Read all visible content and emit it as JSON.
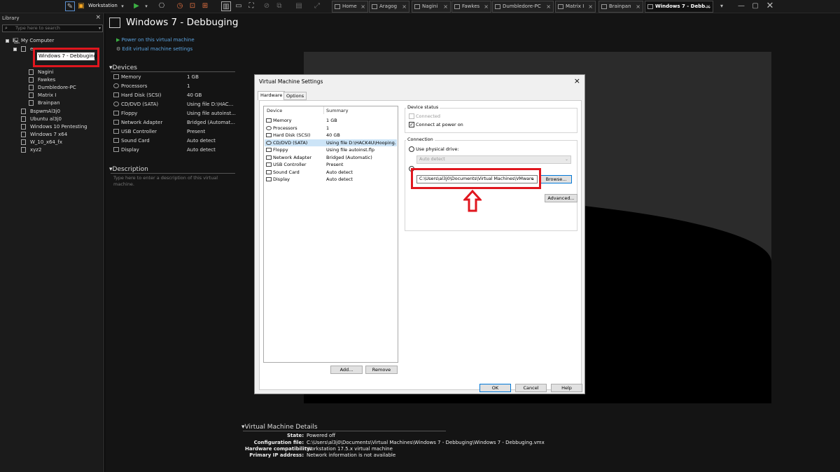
{
  "toolbar": {
    "product": "Workstation"
  },
  "tabs": [
    {
      "label": "Home"
    },
    {
      "label": "Aragog"
    },
    {
      "label": "Nagini"
    },
    {
      "label": "Fawkes"
    },
    {
      "label": "Dumbledore-PC"
    },
    {
      "label": "Matrix I"
    },
    {
      "label": "Brainpan"
    },
    {
      "label": "Windows 7 - Debb..."
    }
  ],
  "library": {
    "title": "Library",
    "close": "×",
    "search_placeholder": "Type here to search",
    "root": "My Computer",
    "group_label": "e",
    "editing_name": "Windows 7 - Debbuging",
    "children": [
      "Nagini",
      "Fawkes",
      "Dumbledore-PC",
      "Matrix I",
      "Brainpan"
    ],
    "items": [
      "BspwmAl3j0",
      "Ubuntu al3j0",
      "Windows 10 Pentesting",
      "Windows 7 x64",
      "W_10_x64_fx",
      "xyz2"
    ]
  },
  "vm": {
    "title": "Windows 7 - Debbuging",
    "actions": {
      "power_on": "Power on this virtual machine",
      "edit": "Edit virtual machine settings"
    },
    "devices_title": "Devices",
    "devices": [
      {
        "name": "Memory",
        "value": "1 GB"
      },
      {
        "name": "Processors",
        "value": "1"
      },
      {
        "name": "Hard Disk (SCSI)",
        "value": "40 GB"
      },
      {
        "name": "CD/DVD (SATA)",
        "value": "Using file D:\\HAC..."
      },
      {
        "name": "Floppy",
        "value": "Using file autoinst..."
      },
      {
        "name": "Network Adapter",
        "value": "Bridged (Automat..."
      },
      {
        "name": "USB Controller",
        "value": "Present"
      },
      {
        "name": "Sound Card",
        "value": "Auto detect"
      },
      {
        "name": "Display",
        "value": "Auto detect"
      }
    ],
    "description_title": "Description",
    "description_placeholder": "Type here to enter a description of this virtual machine.",
    "details_title": "Virtual Machine Details",
    "details": [
      {
        "label": "State:",
        "value": "Powered off"
      },
      {
        "label": "Configuration file:",
        "value": "C:\\Users\\al3j0\\Documents\\Virtual Machines\\Windows 7 - Debbuging\\Windows 7 - Debbuging.vmx"
      },
      {
        "label": "Hardware compatibility:",
        "value": "Workstation 17.5.x virtual machine"
      },
      {
        "label": "Primary IP address:",
        "value": "Network information is not available"
      }
    ]
  },
  "dialog": {
    "title": "Virtual Machine Settings",
    "close": "×",
    "tabs": [
      "Hardware",
      "Options"
    ],
    "list_headers": {
      "device": "Device",
      "summary": "Summary"
    },
    "rows": [
      {
        "name": "Memory",
        "value": "1 GB"
      },
      {
        "name": "Processors",
        "value": "1"
      },
      {
        "name": "Hard Disk (SCSI)",
        "value": "40 GB"
      },
      {
        "name": "CD/DVD (SATA)",
        "value": "Using file D:\\HACK4U\\Hooping..."
      },
      {
        "name": "Floppy",
        "value": "Using file autoinst.flp"
      },
      {
        "name": "Network Adapter",
        "value": "Bridged (Automatic)"
      },
      {
        "name": "USB Controller",
        "value": "Present"
      },
      {
        "name": "Sound Card",
        "value": "Auto detect"
      },
      {
        "name": "Display",
        "value": "Auto detect"
      }
    ],
    "add": "Add...",
    "remove": "Remove",
    "device_status": "Device status",
    "connected": "Connected",
    "connect_power": "Connect at power on",
    "connection": "Connection",
    "physical": "Use physical drive:",
    "auto_detect": "Auto detect",
    "iso_path": "C:\\Users\\al3j0\\Documents\\Virtual Machines\\VMware",
    "browse": "Browse...",
    "advanced": "Advanced...",
    "ok": "OK",
    "cancel": "Cancel",
    "help": "Help"
  },
  "colors": {
    "highlight": "#e0161e",
    "link": "#5ba3e0"
  }
}
